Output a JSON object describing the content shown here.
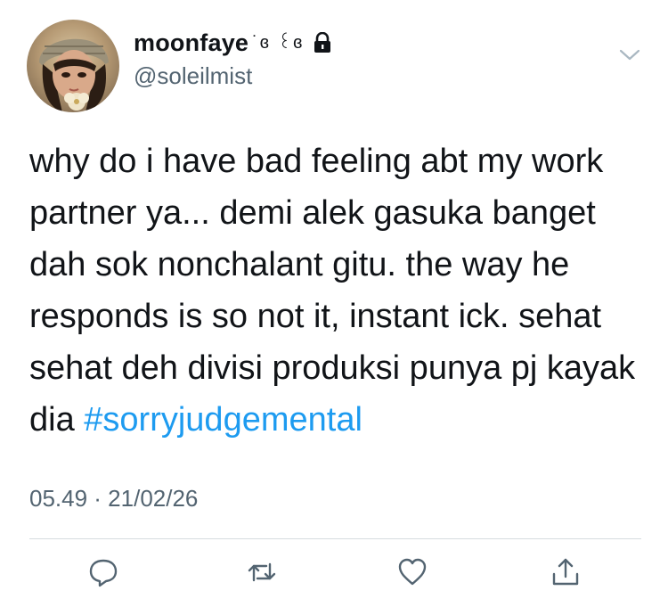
{
  "user": {
    "display_name": "moonfaye",
    "name_decoration": "˙ɞ ꒰ɞ",
    "handle": "@soleilmist",
    "protected": true
  },
  "tweet": {
    "text": "why do i have bad feeling abt my work partner ya... demi alek gasuka banget dah sok nonchalant gitu. the way he responds is so not it, instant ick. sehat sehat deh divisi produksi punya pj kayak dia ",
    "hashtag": "#sorryjudgemental",
    "timestamp": "05.49 · 21/02/26"
  },
  "colors": {
    "text": "#111418",
    "secondary": "#536471",
    "link": "#1d9bf0",
    "divider": "#d6dbdf"
  },
  "icons": {
    "lock": "lock-icon",
    "more": "chevron-down-icon",
    "reply": "reply-icon",
    "retweet": "retweet-icon",
    "like": "heart-icon",
    "share": "share-icon"
  }
}
